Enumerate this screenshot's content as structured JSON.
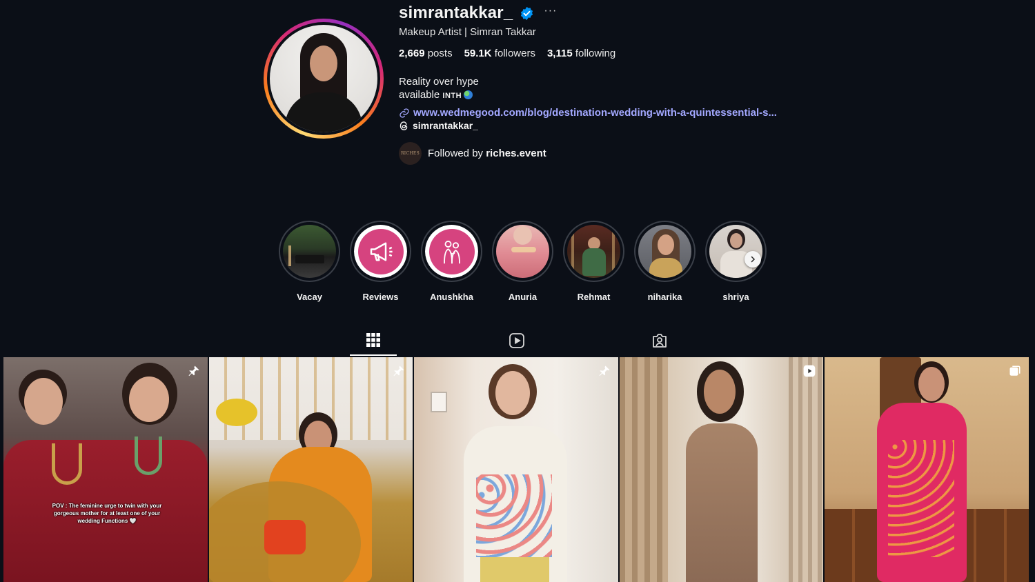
{
  "profile": {
    "username": "simrantakkar_",
    "more_icon": "more-dots-icon",
    "full_name": "Makeup Artist | Simran Takkar",
    "stats": {
      "posts_count": "2,669",
      "posts_label": "posts",
      "followers_count": "59.1K",
      "followers_label": "followers",
      "following_count": "3,115",
      "following_label": "following"
    },
    "bio_line1": "Reality over hype",
    "bio_line2_prefix": "available",
    "bio_line2_caps": "INTH",
    "link_url": "www.wedmegood.com/blog/destination-wedding-with-a-quintessential-s...",
    "threads_handle": "simrantakkar_",
    "followed_by_prefix": "Followed by",
    "followed_by_user": "riches.event",
    "followed_by_avatar_text": "RICHES"
  },
  "highlights": [
    {
      "label": "Vacay"
    },
    {
      "label": "Reviews"
    },
    {
      "label": "Anushkha"
    },
    {
      "label": "Anuria"
    },
    {
      "label": "Rehmat"
    },
    {
      "label": "niharika"
    },
    {
      "label": "shriya"
    }
  ],
  "tabs": [
    {
      "icon": "grid-icon",
      "active": true
    },
    {
      "icon": "reels-icon",
      "active": false
    },
    {
      "icon": "tagged-icon",
      "active": false
    }
  ],
  "posts": [
    {
      "badge": "pin-icon",
      "caption": "POV : The feminine urge to twin with your gorgeous mother for at least one of your wedding Functions 🤍"
    },
    {
      "badge": "pin-icon"
    },
    {
      "badge": "pin-icon"
    },
    {
      "badge": "reel-icon"
    },
    {
      "badge": "carousel-icon"
    }
  ],
  "colors": {
    "background": "#0b0f17",
    "link": "#a3a8ff",
    "verified": "#0095f6",
    "highlight_pink": "#d6437f"
  }
}
